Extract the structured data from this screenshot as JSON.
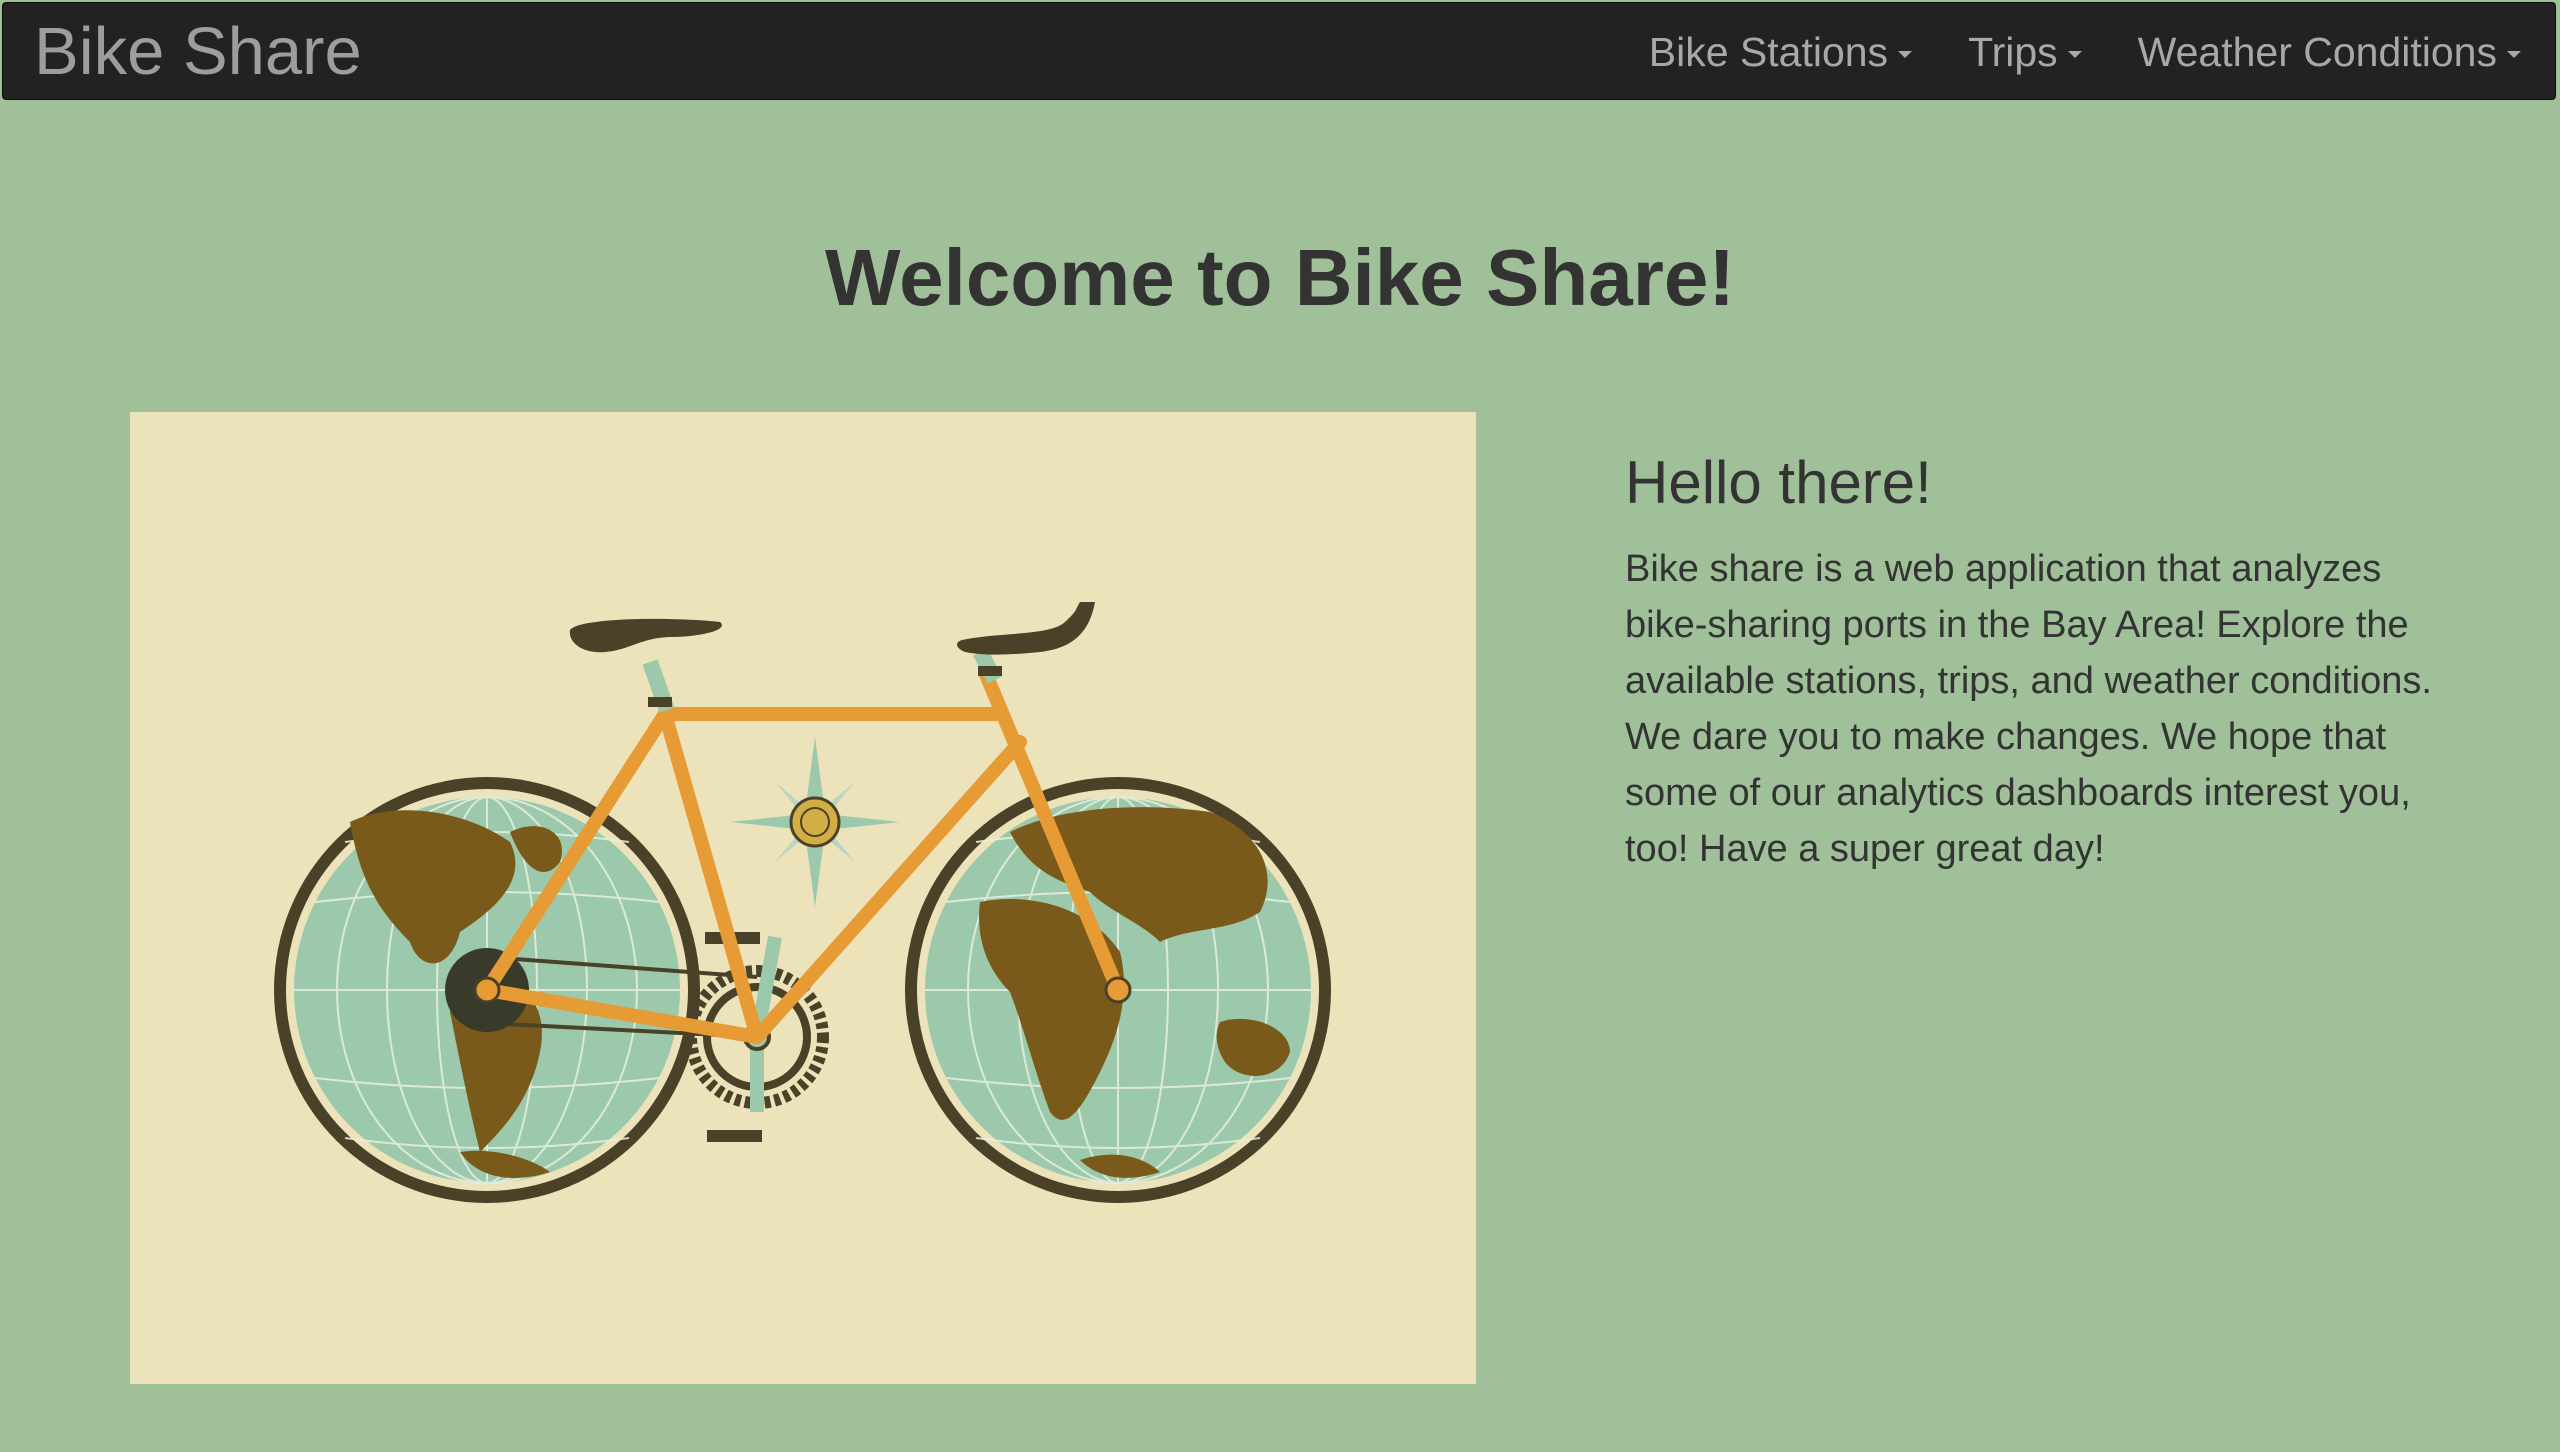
{
  "navbar": {
    "brand": "Bike Share",
    "items": [
      {
        "label": "Bike Stations"
      },
      {
        "label": "Trips"
      },
      {
        "label": "Weather Conditions"
      }
    ]
  },
  "main": {
    "headline": "Welcome to Bike Share!",
    "image": {
      "icon": "bicycle-globe-illustration"
    },
    "intro_title": "Hello there!",
    "intro_text": "Bike share is a web application that analyzes bike-sharing ports in the Bay Area! Explore the available stations, trips, and weather conditions. We dare you to make changes. We hope that some of our analytics dashboards interest you, too! Have a super great day!"
  },
  "colors": {
    "page_background": "#a0c09a",
    "navbar_background": "#222222",
    "image_background": "#ede3bb",
    "frame_orange": "#e69b35",
    "tire_dark": "#4a4129",
    "globe_sea": "#9cc9ab",
    "land": "#7a5a1a"
  }
}
